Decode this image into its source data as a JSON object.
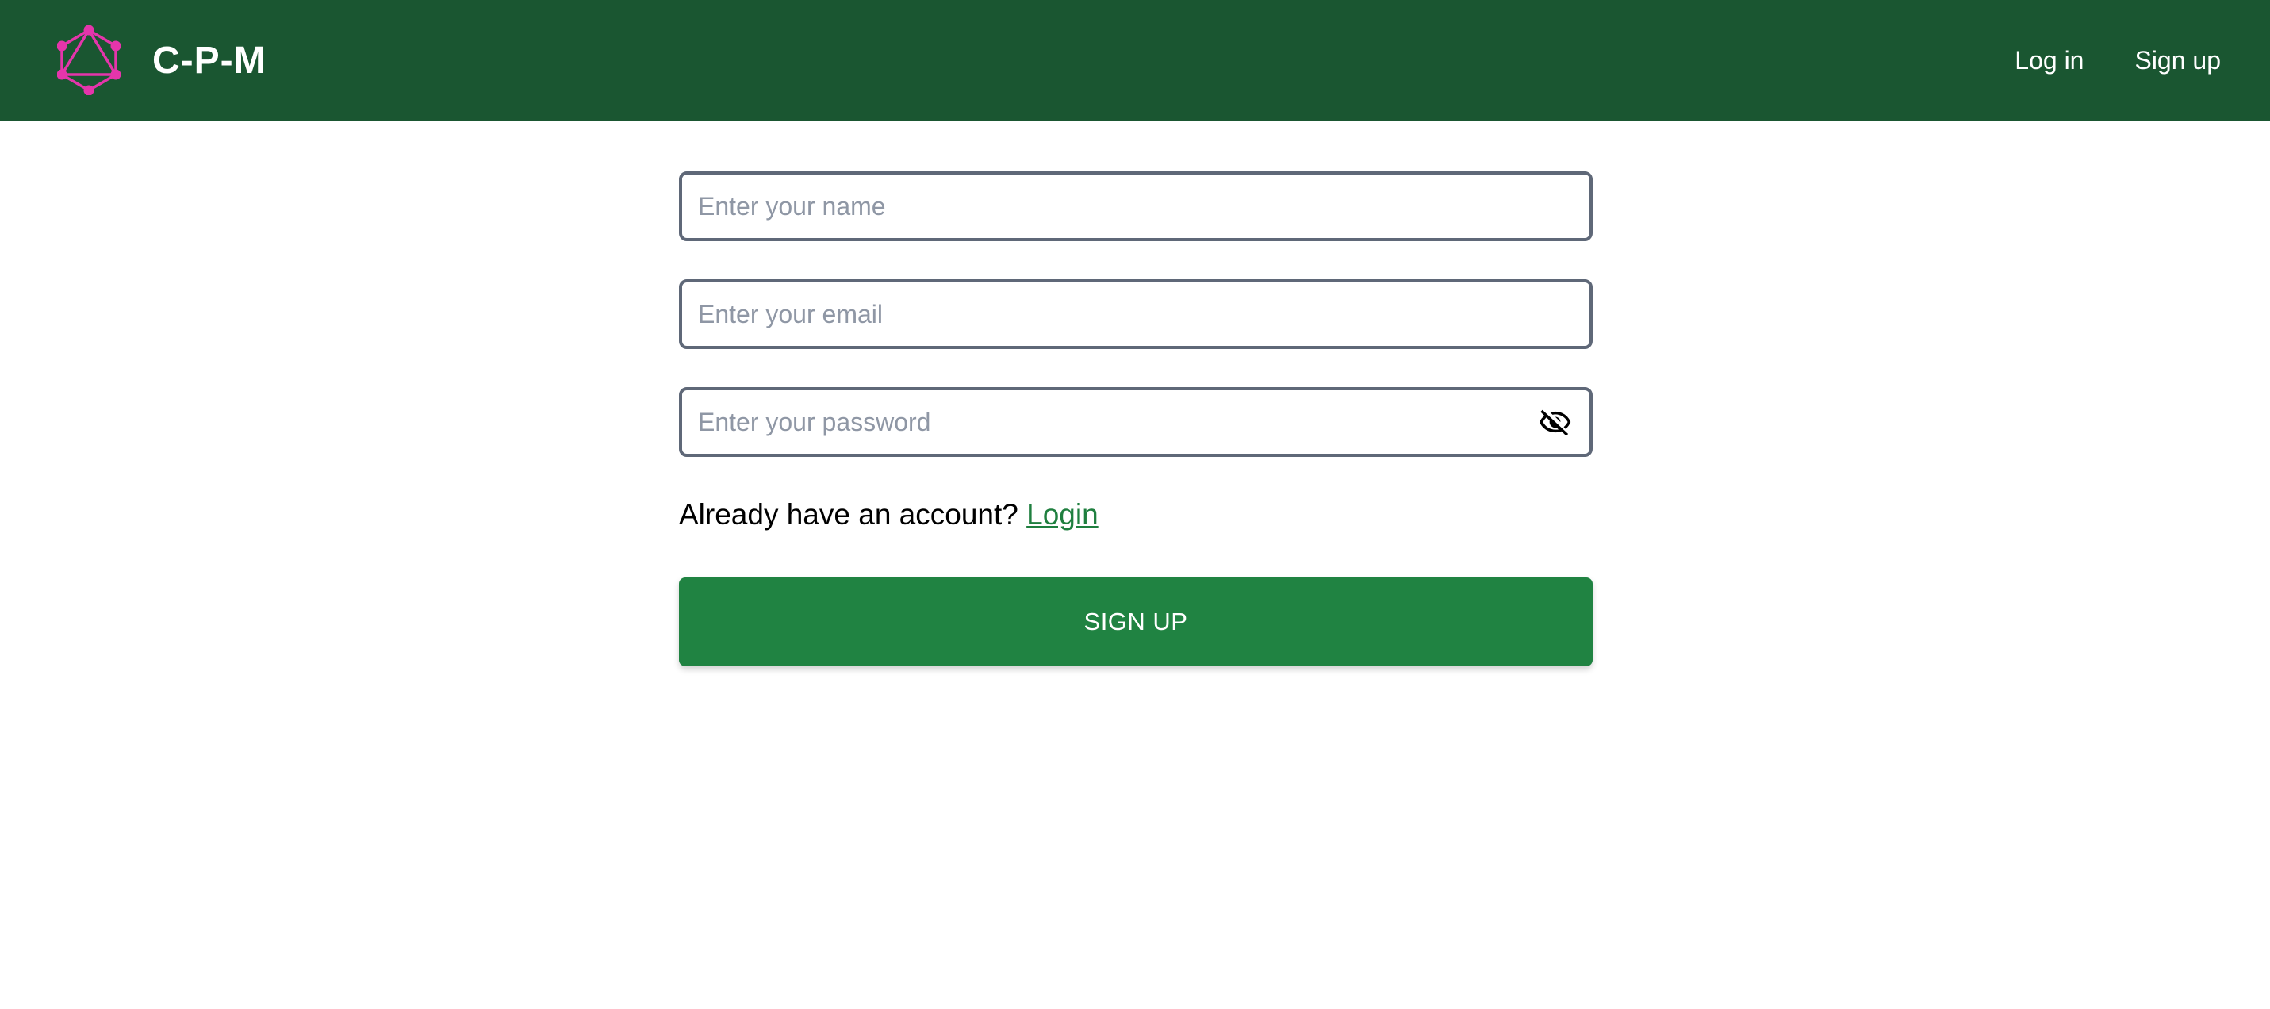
{
  "header": {
    "brand_name": "C-P-M",
    "brand_logo_icon": "graphql-logo-icon",
    "nav": {
      "login_label": "Log in",
      "signup_label": "Sign up"
    }
  },
  "form": {
    "name_placeholder": "Enter your name",
    "name_value": "",
    "email_placeholder": "Enter your email",
    "email_value": "",
    "password_placeholder": "Enter your password",
    "password_value": "",
    "password_toggle_icon": "eye-off-icon",
    "account_prompt": "Already have an account?",
    "login_link_label": "Login",
    "submit_label": "SIGN UP"
  },
  "colors": {
    "navbar": "#1a5631",
    "button": "#208342",
    "link": "#1f7f3f",
    "logo": "#e535ab",
    "input_border": "#5f6878"
  }
}
